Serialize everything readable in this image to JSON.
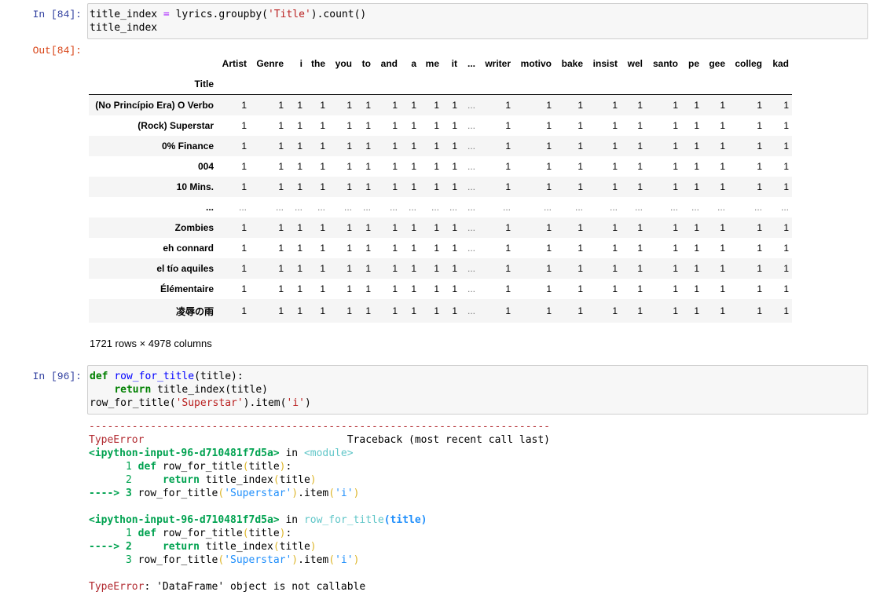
{
  "cell1": {
    "prompt": "In [84]:",
    "lines": [
      [
        [
          "",
          "title_index "
        ],
        [
          "op",
          "="
        ],
        [
          "",
          " lyrics.groupby("
        ],
        [
          "str",
          "'Title'"
        ],
        [
          "",
          ").count()"
        ]
      ],
      [
        [
          "",
          "title_index"
        ]
      ]
    ]
  },
  "out1": {
    "prompt": "Out[84]:",
    "columns": [
      "Artist",
      "Genre",
      "i",
      "the",
      "you",
      "to",
      "and",
      "a",
      "me",
      "it",
      "...",
      "writer",
      "motivo",
      "bake",
      "insist",
      "wel",
      "santo",
      "pe",
      "gee",
      "colleg",
      "kad"
    ],
    "index_name": "Title",
    "rows": [
      {
        "title": "(No Princípio Era) O Verbo",
        "values": [
          "1",
          "1",
          "1",
          "1",
          "1",
          "1",
          "1",
          "1",
          "1",
          "1",
          "...",
          "1",
          "1",
          "1",
          "1",
          "1",
          "1",
          "1",
          "1",
          "1",
          "1"
        ]
      },
      {
        "title": "(Rock) Superstar",
        "values": [
          "1",
          "1",
          "1",
          "1",
          "1",
          "1",
          "1",
          "1",
          "1",
          "1",
          "...",
          "1",
          "1",
          "1",
          "1",
          "1",
          "1",
          "1",
          "1",
          "1",
          "1"
        ]
      },
      {
        "title": "0% Finance",
        "values": [
          "1",
          "1",
          "1",
          "1",
          "1",
          "1",
          "1",
          "1",
          "1",
          "1",
          "...",
          "1",
          "1",
          "1",
          "1",
          "1",
          "1",
          "1",
          "1",
          "1",
          "1"
        ]
      },
      {
        "title": "004",
        "values": [
          "1",
          "1",
          "1",
          "1",
          "1",
          "1",
          "1",
          "1",
          "1",
          "1",
          "...",
          "1",
          "1",
          "1",
          "1",
          "1",
          "1",
          "1",
          "1",
          "1",
          "1"
        ]
      },
      {
        "title": "10 Mins.",
        "values": [
          "1",
          "1",
          "1",
          "1",
          "1",
          "1",
          "1",
          "1",
          "1",
          "1",
          "...",
          "1",
          "1",
          "1",
          "1",
          "1",
          "1",
          "1",
          "1",
          "1",
          "1"
        ]
      },
      {
        "title": "...",
        "values": [
          "...",
          "...",
          "...",
          "...",
          "...",
          "...",
          "...",
          "...",
          "...",
          "...",
          "...",
          "...",
          "...",
          "...",
          "...",
          "...",
          "...",
          "...",
          "...",
          "...",
          "..."
        ]
      },
      {
        "title": "Zombies",
        "values": [
          "1",
          "1",
          "1",
          "1",
          "1",
          "1",
          "1",
          "1",
          "1",
          "1",
          "...",
          "1",
          "1",
          "1",
          "1",
          "1",
          "1",
          "1",
          "1",
          "1",
          "1"
        ]
      },
      {
        "title": "eh connard",
        "values": [
          "1",
          "1",
          "1",
          "1",
          "1",
          "1",
          "1",
          "1",
          "1",
          "1",
          "...",
          "1",
          "1",
          "1",
          "1",
          "1",
          "1",
          "1",
          "1",
          "1",
          "1"
        ]
      },
      {
        "title": "el tío aquiles",
        "values": [
          "1",
          "1",
          "1",
          "1",
          "1",
          "1",
          "1",
          "1",
          "1",
          "1",
          "...",
          "1",
          "1",
          "1",
          "1",
          "1",
          "1",
          "1",
          "1",
          "1",
          "1"
        ]
      },
      {
        "title": "Élémentaire",
        "values": [
          "1",
          "1",
          "1",
          "1",
          "1",
          "1",
          "1",
          "1",
          "1",
          "1",
          "...",
          "1",
          "1",
          "1",
          "1",
          "1",
          "1",
          "1",
          "1",
          "1",
          "1"
        ]
      },
      {
        "title": "凌辱の雨",
        "values": [
          "1",
          "1",
          "1",
          "1",
          "1",
          "1",
          "1",
          "1",
          "1",
          "1",
          "...",
          "1",
          "1",
          "1",
          "1",
          "1",
          "1",
          "1",
          "1",
          "1",
          "1"
        ]
      }
    ],
    "shape": "1721 rows × 4978 columns"
  },
  "cell2": {
    "prompt": "In [96]:",
    "lines": [
      [
        [
          "kw",
          "def"
        ],
        [
          "",
          " "
        ],
        [
          "fn",
          "row_for_title"
        ],
        [
          "",
          "(title):"
        ]
      ],
      [
        [
          "",
          "    "
        ],
        [
          "kw",
          "return"
        ],
        [
          "",
          " title_index(title)"
        ]
      ],
      [
        [
          "",
          "row_for_title("
        ],
        [
          "str",
          "'Superstar'"
        ],
        [
          "",
          ").item("
        ],
        [
          "str",
          "'i'"
        ],
        [
          "",
          ")"
        ]
      ]
    ]
  },
  "traceback": {
    "lines": [
      [
        [
          "red",
          "---------------------------------------------------------------------------"
        ]
      ],
      [
        [
          "red",
          "TypeError"
        ],
        [
          "",
          "                                 Traceback (most recent call last)"
        ]
      ],
      [
        [
          "grn",
          "<ipython-input-96-d710481f7d5a>"
        ],
        [
          "",
          " in "
        ],
        [
          "cyn",
          "<module>"
        ]
      ],
      [
        [
          "ln",
          "      1 "
        ],
        [
          "grn",
          "def"
        ],
        [
          "",
          " row_for_title"
        ],
        [
          "ylw",
          "("
        ],
        [
          "",
          "title"
        ],
        [
          "ylw",
          ")"
        ],
        [
          "",
          ":"
        ]
      ],
      [
        [
          "ln",
          "      2 "
        ],
        [
          "",
          "    "
        ],
        [
          "grn",
          "return"
        ],
        [
          "",
          " title_index"
        ],
        [
          "ylw",
          "("
        ],
        [
          "",
          "title"
        ],
        [
          "ylw",
          ")"
        ]
      ],
      [
        [
          "grn",
          "----> 3 "
        ],
        [
          "",
          "row_for_title"
        ],
        [
          "ylw",
          "("
        ],
        [
          "blu",
          "'Superstar'"
        ],
        [
          "ylw",
          ")"
        ],
        [
          "",
          ".item"
        ],
        [
          "ylw",
          "("
        ],
        [
          "blu",
          "'i'"
        ],
        [
          "ylw",
          ")"
        ]
      ],
      [
        [
          "",
          ""
        ]
      ],
      [
        [
          "grn",
          "<ipython-input-96-d710481f7d5a>"
        ],
        [
          "",
          " in "
        ],
        [
          "cyn",
          "row_for_title"
        ],
        [
          "blub",
          "(title)"
        ]
      ],
      [
        [
          "ln",
          "      1 "
        ],
        [
          "grn",
          "def"
        ],
        [
          "",
          " row_for_title"
        ],
        [
          "ylw",
          "("
        ],
        [
          "",
          "title"
        ],
        [
          "ylw",
          ")"
        ],
        [
          "",
          ":"
        ]
      ],
      [
        [
          "grn",
          "----> 2 "
        ],
        [
          "",
          "    "
        ],
        [
          "grn",
          "return"
        ],
        [
          "",
          " title_index"
        ],
        [
          "ylw",
          "("
        ],
        [
          "",
          "title"
        ],
        [
          "ylw",
          ")"
        ]
      ],
      [
        [
          "ln",
          "      3 "
        ],
        [
          "",
          "row_for_title"
        ],
        [
          "ylw",
          "("
        ],
        [
          "blu",
          "'Superstar'"
        ],
        [
          "ylw",
          ")"
        ],
        [
          "",
          ".item"
        ],
        [
          "ylw",
          "("
        ],
        [
          "blu",
          "'i'"
        ],
        [
          "ylw",
          ")"
        ]
      ],
      [
        [
          "",
          ""
        ]
      ],
      [
        [
          "red",
          "TypeError"
        ],
        [
          "",
          ": 'DataFrame' object is not callable"
        ]
      ]
    ]
  }
}
